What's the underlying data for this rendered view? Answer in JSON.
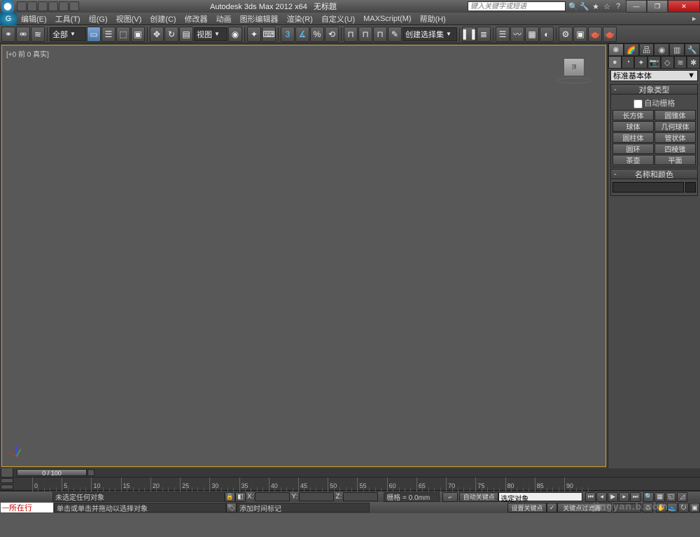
{
  "title": {
    "app": "Autodesk 3ds Max 2012 x64",
    "doc": "无标题"
  },
  "search": {
    "placeholder": "键入关键字或短语"
  },
  "menu": [
    "编辑(E)",
    "工具(T)",
    "组(G)",
    "视图(V)",
    "创建(C)",
    "修改器",
    "动画",
    "图形编辑器",
    "渲染(R)",
    "自定义(U)",
    "MAXScript(M)",
    "帮助(H)"
  ],
  "toolbar": {
    "selection_filter": "全部",
    "refcoord": "视图",
    "render_num": "3",
    "named_selection": "创建选择集"
  },
  "viewport": {
    "label": "[+0 前 0 真实]",
    "cube": "顶"
  },
  "cmd": {
    "category": "标准基本体",
    "obj_type_title": "对象类型",
    "autogrid": "自动栅格",
    "buttons": [
      [
        "长方体",
        "圆锥体"
      ],
      [
        "球体",
        "几何球体"
      ],
      [
        "圆柱体",
        "管状体"
      ],
      [
        "圆环",
        "四棱锥"
      ],
      [
        "茶壶",
        "平面"
      ]
    ],
    "name_color_title": "名称和颜色"
  },
  "time": {
    "slider": "0 / 100",
    "ticks": [
      0,
      5,
      10,
      15,
      20,
      25,
      30,
      35,
      40,
      45,
      50,
      55,
      60,
      65,
      70,
      75,
      80,
      85,
      90
    ]
  },
  "status": {
    "no_sel": "未选定任何对象",
    "hint": "单击或单击并拖动以选择对象",
    "add_time": "添加时间标记",
    "grid": "栅格 = 0.0mm",
    "layer": "所在行",
    "x": "X:",
    "y": "Y:",
    "z": "Z:",
    "autokey": "自动关键点",
    "setkey": "设置关键点",
    "sel_obj": "选定对象",
    "keyfilter": "关键点过滤器..."
  }
}
